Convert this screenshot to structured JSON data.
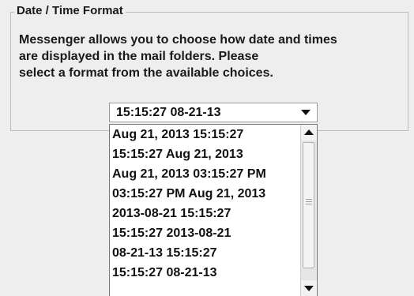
{
  "group": {
    "title": "Date / Time Format",
    "description_lines": [
      "Messenger allows you to choose how date and times",
      "are displayed in the mail folders.  Please",
      "select a format from the available choices."
    ]
  },
  "combo": {
    "selected_value": "15:15:27 08-21-13",
    "arrow_icon": "chevron-down-icon"
  },
  "dropdown": {
    "options": [
      "Aug 21, 2013 15:15:27",
      "15:15:27 Aug 21, 2013",
      "Aug 21, 2013 03:15:27 PM",
      "03:15:27 PM Aug 21, 2013",
      "2013-08-21 15:15:27",
      "15:15:27 2013-08-21",
      "08-21-13 15:15:27",
      "15:15:27 08-21-13"
    ]
  }
}
